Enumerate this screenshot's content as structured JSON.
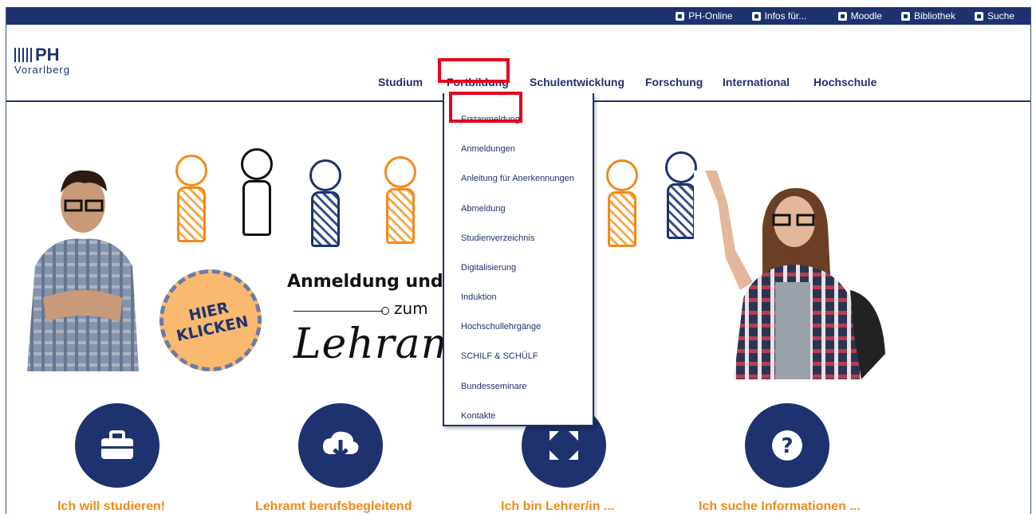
{
  "caption_partial": "g",
  "topbar": {
    "links": [
      {
        "label": "PH-Online",
        "icon": "ph-online-icon"
      },
      {
        "label": "Infos für...",
        "icon": "info-person-icon"
      },
      {
        "label": "Moodle",
        "icon": "moodle-icon"
      },
      {
        "label": "Bibliothek",
        "icon": "library-icon"
      },
      {
        "label": "Suche",
        "icon": "search-icon"
      }
    ]
  },
  "logo": {
    "main": "PH",
    "sub": "Vorarlberg"
  },
  "nav": {
    "items": [
      "Studium",
      "Fortbildung",
      "Schulentwicklung",
      "Forschung",
      "International",
      "Hochschule"
    ]
  },
  "dropdown": {
    "items": [
      "Erstanmeldung",
      "Anmeldungen",
      "Anleitung für Anerkennungen",
      "Abmeldung",
      "Studienverzeichnis",
      "Digitalisierung",
      "Induktion",
      "Hochschullehrgänge",
      "SCHILF & SCHÜLF",
      "Bundesseminare",
      "Kontakte"
    ]
  },
  "hero": {
    "badge_line1": "HIER",
    "badge_line2": "KLICKEN",
    "title": "Anmeldung und",
    "sub": "zum",
    "script": "Lehramtss"
  },
  "ctas": [
    {
      "label": "Ich will studieren!",
      "icon": "briefcase-icon"
    },
    {
      "label": "Lehramt berufsbegleitend",
      "icon": "cloud-download-icon"
    },
    {
      "label": "Ich bin Lehrer/in ...",
      "icon": "expand-arrows-icon"
    },
    {
      "label": "Ich suche Informationen ...",
      "icon": "question-icon"
    }
  ],
  "colors": {
    "brand_navy": "#1e3270",
    "accent_orange": "#f28a1a",
    "highlight_red": "#e5001c"
  }
}
